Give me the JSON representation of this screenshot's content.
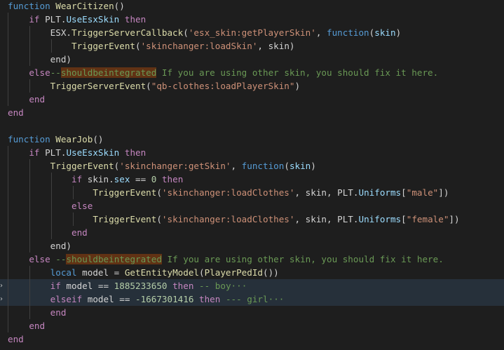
{
  "editor": {
    "lines": [
      [
        [
          "kw",
          "function"
        ],
        [
          "plain",
          " "
        ],
        [
          "fn",
          "WearCitizen"
        ],
        [
          "plain",
          "()"
        ]
      ],
      [
        [
          "plain",
          "    "
        ],
        [
          "ctl",
          "if"
        ],
        [
          "plain",
          " PLT."
        ],
        [
          "var",
          "UseEsxSkin"
        ],
        [
          "plain",
          " "
        ],
        [
          "ctl",
          "then"
        ]
      ],
      [
        [
          "plain",
          "        ESX."
        ],
        [
          "fn",
          "TriggerServerCallback"
        ],
        [
          "plain",
          "("
        ],
        [
          "str",
          "'esx_skin:getPlayerSkin'"
        ],
        [
          "plain",
          ", "
        ],
        [
          "kw",
          "function"
        ],
        [
          "plain",
          "("
        ],
        [
          "var",
          "skin"
        ],
        [
          "plain",
          ")"
        ]
      ],
      [
        [
          "plain",
          "            "
        ],
        [
          "fn",
          "TriggerEvent"
        ],
        [
          "plain",
          "("
        ],
        [
          "str",
          "'skinchanger:loadSkin'"
        ],
        [
          "plain",
          ", skin)"
        ]
      ],
      [
        [
          "plain",
          "        end)"
        ]
      ],
      [
        [
          "plain",
          "    "
        ],
        [
          "ctl",
          "else"
        ],
        [
          "cm",
          "--"
        ],
        [
          "box",
          "shouldbeintegrated"
        ],
        [
          "cm",
          " If you are using other skin, you should fix it here."
        ]
      ],
      [
        [
          "plain",
          "        "
        ],
        [
          "fn",
          "TriggerServerEvent"
        ],
        [
          "plain",
          "("
        ],
        [
          "str",
          "\"qb-clothes:loadPlayerSkin\""
        ],
        [
          "plain",
          ")"
        ]
      ],
      [
        [
          "plain",
          "    "
        ],
        [
          "ctl",
          "end"
        ]
      ],
      [
        [
          "ctl",
          "end"
        ]
      ],
      [],
      [
        [
          "kw",
          "function"
        ],
        [
          "plain",
          " "
        ],
        [
          "fn",
          "WearJob"
        ],
        [
          "plain",
          "()"
        ]
      ],
      [
        [
          "plain",
          "    "
        ],
        [
          "ctl",
          "if"
        ],
        [
          "plain",
          " PLT."
        ],
        [
          "var",
          "UseEsxSkin"
        ],
        [
          "plain",
          " "
        ],
        [
          "ctl",
          "then"
        ]
      ],
      [
        [
          "plain",
          "        "
        ],
        [
          "fn",
          "TriggerEvent"
        ],
        [
          "plain",
          "("
        ],
        [
          "str",
          "'skinchanger:getSkin'"
        ],
        [
          "plain",
          ", "
        ],
        [
          "kw",
          "function"
        ],
        [
          "plain",
          "("
        ],
        [
          "var",
          "skin"
        ],
        [
          "plain",
          ")"
        ]
      ],
      [
        [
          "plain",
          "            "
        ],
        [
          "ctl",
          "if"
        ],
        [
          "plain",
          " skin."
        ],
        [
          "var",
          "sex"
        ],
        [
          "plain",
          " == "
        ],
        [
          "num",
          "0"
        ],
        [
          "plain",
          " "
        ],
        [
          "ctl",
          "then"
        ]
      ],
      [
        [
          "plain",
          "                "
        ],
        [
          "fn",
          "TriggerEvent"
        ],
        [
          "plain",
          "("
        ],
        [
          "str",
          "'skinchanger:loadClothes'"
        ],
        [
          "plain",
          ", skin, PLT."
        ],
        [
          "var",
          "Uniforms"
        ],
        [
          "plain",
          "["
        ],
        [
          "str",
          "\"male\""
        ],
        [
          "plain",
          "])"
        ]
      ],
      [
        [
          "plain",
          "            "
        ],
        [
          "ctl",
          "else"
        ]
      ],
      [
        [
          "plain",
          "                "
        ],
        [
          "fn",
          "TriggerEvent"
        ],
        [
          "plain",
          "("
        ],
        [
          "str",
          "'skinchanger:loadClothes'"
        ],
        [
          "plain",
          ", skin, PLT."
        ],
        [
          "var",
          "Uniforms"
        ],
        [
          "plain",
          "["
        ],
        [
          "str",
          "\"female\""
        ],
        [
          "plain",
          "])"
        ]
      ],
      [
        [
          "plain",
          "            "
        ],
        [
          "ctl",
          "end"
        ]
      ],
      [
        [
          "plain",
          "        end)"
        ]
      ],
      [
        [
          "plain",
          "    "
        ],
        [
          "ctl",
          "else"
        ],
        [
          "plain",
          " "
        ],
        [
          "cm",
          "--"
        ],
        [
          "box",
          "shouldbeintegrated"
        ],
        [
          "cm",
          " If you are using other skin, you should fix it here."
        ]
      ],
      [
        [
          "plain",
          "        "
        ],
        [
          "kw",
          "local"
        ],
        [
          "plain",
          " model = "
        ],
        [
          "fn",
          "GetEntityModel"
        ],
        [
          "plain",
          "("
        ],
        [
          "fn",
          "PlayerPedId"
        ],
        [
          "plain",
          "())"
        ]
      ],
      [
        [
          "plain",
          "        "
        ],
        [
          "ctl",
          "if"
        ],
        [
          "plain",
          " model == "
        ],
        [
          "num",
          "1885233650"
        ],
        [
          "plain",
          " "
        ],
        [
          "ctl",
          "then"
        ],
        [
          "plain",
          " "
        ],
        [
          "cm",
          "-- boy"
        ],
        [
          "ell",
          "···"
        ]
      ],
      [
        [
          "plain",
          "        "
        ],
        [
          "ctl",
          "elseif"
        ],
        [
          "plain",
          " model == "
        ],
        [
          "num",
          "-1667301416"
        ],
        [
          "plain",
          " "
        ],
        [
          "ctl",
          "then"
        ],
        [
          "plain",
          " "
        ],
        [
          "cm",
          "--- girl"
        ],
        [
          "ell",
          "···"
        ]
      ],
      [
        [
          "plain",
          "        "
        ],
        [
          "ctl",
          "end"
        ]
      ],
      [
        [
          "plain",
          "    "
        ],
        [
          "ctl",
          "end"
        ]
      ],
      [
        [
          "ctl",
          "end"
        ]
      ]
    ],
    "highlighted_lines": [
      21,
      22
    ],
    "folded_lines": [
      21,
      22
    ],
    "fold_marker": "›",
    "colors": {
      "background": "#1e1e1e",
      "keyword": "#569cd6",
      "control": "#c586c0",
      "function": "#dcdcaa",
      "variable": "#9cdcfe",
      "string": "#ce9178",
      "number": "#b5cea8",
      "comment": "#6a9955",
      "highlight_box": "#613214",
      "line_highlight": "#26303a"
    }
  }
}
